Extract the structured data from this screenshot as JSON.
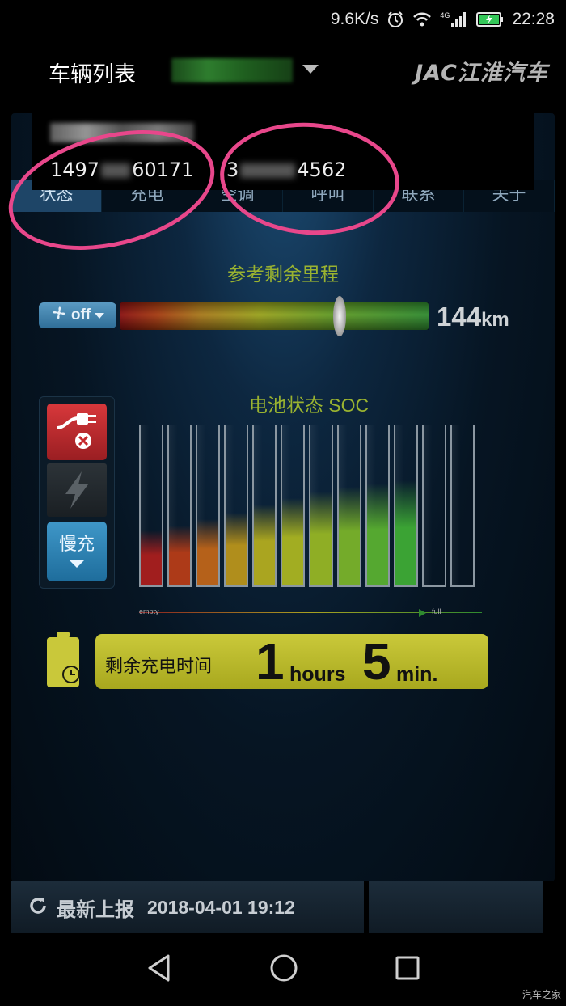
{
  "status_bar": {
    "speed": "9.6K/s",
    "network": "4G",
    "time": "22:28"
  },
  "app_bar": {
    "title": "车辆列表",
    "brand": "JAC江淮汽车"
  },
  "tabs": [
    {
      "label": "状态",
      "active": true
    },
    {
      "label": "充电",
      "active": false
    },
    {
      "label": "空调",
      "active": false
    },
    {
      "label": "呼叫",
      "active": false
    },
    {
      "label": "联系",
      "active": false
    },
    {
      "label": "关于",
      "active": false
    }
  ],
  "popup": {
    "phone_1": "1497",
    "phone_1_b": "60171",
    "phone_2_a": "3",
    "phone_2_b": "4562"
  },
  "range": {
    "title": "参考剩余里程",
    "fan_label": "off",
    "value": "144",
    "unit": "km",
    "slider_fraction": 0.72
  },
  "side_controls": {
    "slow_charge_label": "慢充"
  },
  "soc": {
    "title": "电池状态 SOC",
    "axis_empty": "empty",
    "axis_full": "full",
    "bars_total": 12,
    "bars_filled": 10,
    "colors": [
      "#a11e1e",
      "#ad3a18",
      "#b5611a",
      "#b08e1c",
      "#aaa520",
      "#a2ad22",
      "#8fae25",
      "#74ab2a",
      "#55a830",
      "#3ba334"
    ]
  },
  "charge_time": {
    "label": "剩余充电时间",
    "hours": "1",
    "hours_unit": "hours",
    "minutes": "5",
    "minutes_unit": "min."
  },
  "footer": {
    "label": "最新上报",
    "timestamp": "2018-04-01 19:12"
  },
  "watermark": "汽车之家"
}
